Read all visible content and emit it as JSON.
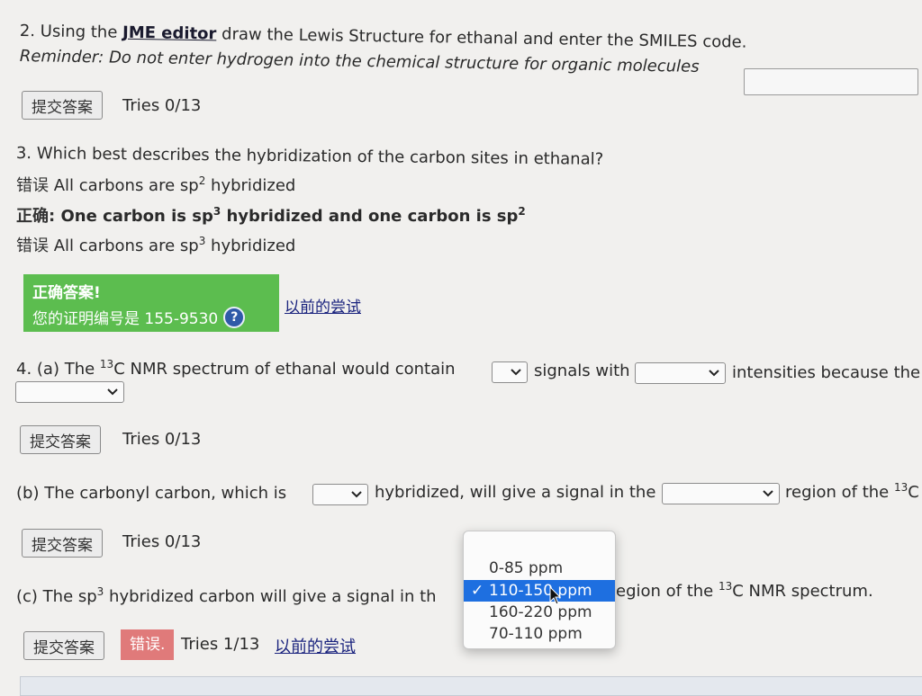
{
  "q2": {
    "prefix": "2. Using the",
    "editor_link": "JME editor",
    "rest": "draw the Lewis Structure for ethanal and enter the SMILES code.",
    "reminder": "Reminder: Do not enter hydrogen into the chemical structure for organic molecules",
    "submit_label": "提交答案",
    "tries": "Tries 0/13"
  },
  "q3": {
    "question": "3. Which best describes the hybridization of the carbon sites in ethanal?",
    "choices": [
      {
        "tag": "错误",
        "pre": "All carbons are sp",
        "sup": "2",
        "post": " hybridized"
      },
      {
        "tag": "正确:",
        "pre": "One carbon is sp",
        "sup": "3",
        "mid": " hybridized and one carbon is sp",
        "sup2": "2"
      },
      {
        "tag": "错误",
        "pre": "All carbons are sp",
        "sup": "3",
        "post": " hybridized"
      }
    ],
    "feedback_title": "正确答案!",
    "feedback_cert": "您的证明编号是 155-9530",
    "previous_attempts": "以前的尝试"
  },
  "q4a": {
    "pre": "4. (a) The ",
    "sup": "13",
    "mid1": "C NMR spectrum of ethanal would contain",
    "mid2": "signals with",
    "mid3": "intensities because the c",
    "submit_label": "提交答案",
    "tries": "Tries 0/13"
  },
  "q4b": {
    "pre": "(b) The carbonyl carbon, which is",
    "mid": "hybridized, will give a signal in the",
    "post": "region of the ",
    "sup": "13",
    "post2": "C",
    "submit_label": "提交答案",
    "tries": "Tries 0/13"
  },
  "q4c": {
    "pre": "(c) The sp",
    "sup": "3",
    "mid": " hybridized carbon will give a signal in th",
    "post": "egion of the ",
    "sup2": "13",
    "post2": "C NMR spectrum.",
    "submit_label": "提交答案",
    "wrong_label": "错误.",
    "tries": "Tries 1/13",
    "previous_attempts": "以前的尝试"
  },
  "dropdown": {
    "options": [
      "0-85 ppm",
      "110-150 ppm",
      "160-220 ppm",
      "70-110 ppm"
    ],
    "selected_index": 1,
    "check": "✓"
  },
  "colors": {
    "correct_bg": "#5cbd4f",
    "wrong_bg": "#e07a7a",
    "selected_bg": "#1e6fe0"
  }
}
